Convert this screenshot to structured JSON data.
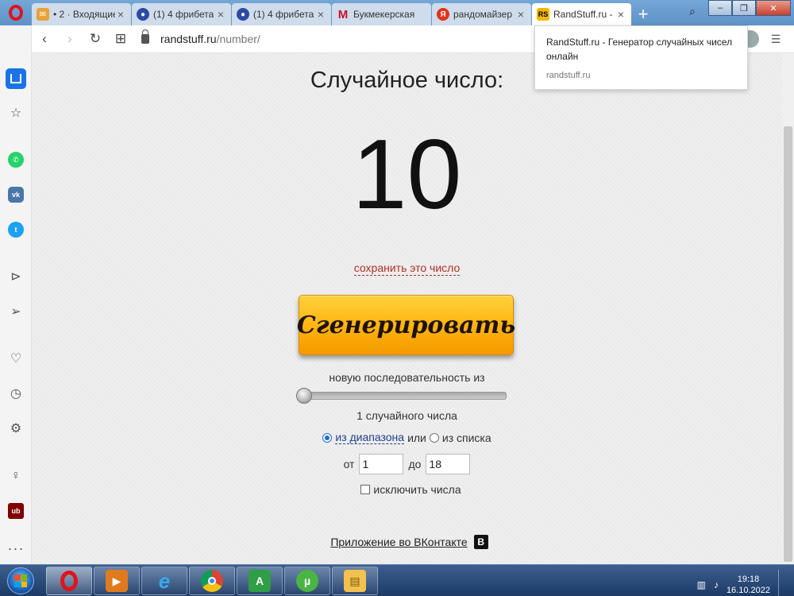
{
  "tabs": [
    {
      "label": "• 2 · Входящие",
      "icon": "mail-icon",
      "color": "#e8a23a"
    },
    {
      "label": "(1) 4 фрибета",
      "icon": "site-icon",
      "color": "#2b4aa6"
    },
    {
      "label": "(1) 4 фрибета",
      "icon": "site-icon",
      "color": "#2b4aa6"
    },
    {
      "label": "Букмекерская",
      "icon": "m-icon",
      "color": "#c8102e"
    },
    {
      "label": "рандомайзер",
      "icon": "yandex-icon",
      "color": "#e3311d"
    },
    {
      "label": "RandStuff.ru -",
      "icon": "randstuff-icon",
      "color": "#f5b800",
      "active": true
    }
  ],
  "address": {
    "host": "randstuff.ru",
    "path": "/number/"
  },
  "tooltip": {
    "title": "RandStuff.ru - Генератор случайных чисел онлайн",
    "url": "randstuff.ru"
  },
  "page": {
    "title": "Случайное число:",
    "number": "10",
    "save_link": "сохранить это число",
    "generate_button": "Сгенерировать",
    "sequence_label": "новую последовательность из",
    "count_label": "1 случайного числа",
    "count_value": 1,
    "range_option": "из диапазона",
    "or_text": "или",
    "list_option": "из списка",
    "from_label": "от",
    "from_value": "1",
    "to_label": "до",
    "to_value": "18",
    "exclude_label": "исключить числа",
    "vk_link": "Приложение во ВКонтакте",
    "vk_icon": "В"
  },
  "taskbar": {
    "time": "19:18",
    "date": "16.10.2022"
  },
  "colors": {
    "accent": "#1a73e8",
    "button": "#ffb20c",
    "link_red": "#b03020"
  }
}
